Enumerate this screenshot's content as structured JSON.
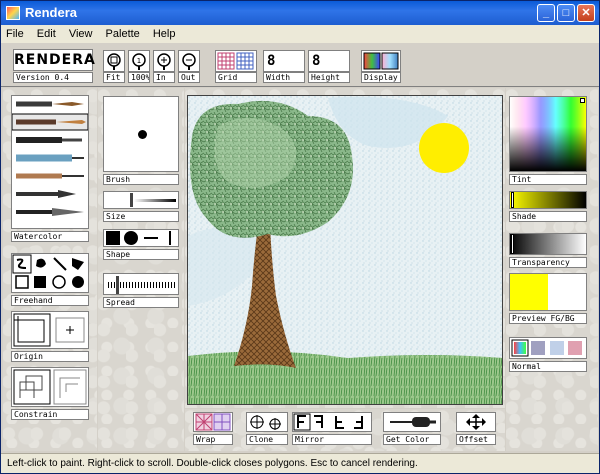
{
  "app": {
    "title": "Rendera"
  },
  "menu": [
    "File",
    "Edit",
    "View",
    "Palette",
    "Help"
  ],
  "toolbar": {
    "logo": "RENDERA",
    "version": "Version 0.4",
    "fit": "Fit",
    "zoom100": "100%",
    "zoom_in": "In",
    "zoom_out": "Out",
    "grid": "Grid",
    "width_value": "8",
    "width_label": "Width",
    "height_value": "8",
    "height_label": "Height",
    "display": "Display"
  },
  "left": {
    "watercolor": "Watercolor",
    "freehand": "Freehand",
    "origin": "Origin",
    "constrain": "Constrain"
  },
  "brush": {
    "brush": "Brush",
    "size": "Size",
    "shape": "Shape",
    "spread": "Spread"
  },
  "right": {
    "tint": "Tint",
    "shade": "Shade",
    "transparency": "Transparency",
    "preview": "Preview FG/BG",
    "normal": "Normal",
    "fg_color": "#ffff00",
    "bg_color": "#ffffff"
  },
  "bottom": {
    "wrap": "Wrap",
    "clone": "Clone",
    "mirror": "Mirror",
    "get_color": "Get Color",
    "offset": "Offset"
  },
  "status": "Left-click to paint. Right-click to scroll. Double-click closes polygons. Esc to cancel rendering."
}
